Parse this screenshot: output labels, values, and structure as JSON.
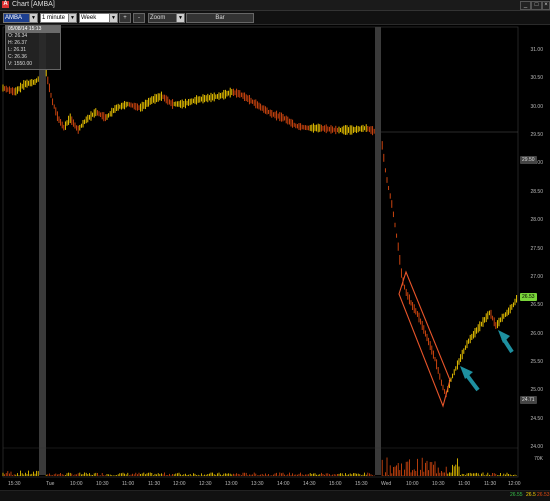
{
  "window": {
    "title": "Chart [AMBA]",
    "app_icon": "chart-app-icon",
    "controls": [
      "minimize",
      "maximize",
      "close"
    ]
  },
  "toolbar": {
    "symbol": "AMBA",
    "interval": "1 minute",
    "range": "Week",
    "plus_label": "+",
    "minus_label": "-",
    "zoom_label": "Zoom",
    "bar_label": "Bar"
  },
  "info": {
    "header": "05/08/14 15:13",
    "open": "O: 26.34",
    "high": "H: 26.37",
    "low": "L: 26.31",
    "close": "C: 26.36",
    "volume": "V: 1550.00"
  },
  "price_axis": [
    "31.00",
    "30.50",
    "30.00",
    "29.50",
    "29.00",
    "28.50",
    "28.00",
    "27.50",
    "27.00",
    "26.50",
    "26.00",
    "25.50",
    "25.00",
    "24.50",
    "24.00"
  ],
  "price_tags": {
    "prev_close": "29.50",
    "last": "26.53",
    "low_marker": "24.71"
  },
  "volume_label": "70K",
  "time_axis": [
    "15:30",
    "Tue",
    "10:00",
    "10:30",
    "11:00",
    "11:30",
    "12:00",
    "12:30",
    "13:00",
    "13:30",
    "14:00",
    "14:30",
    "15:00",
    "15:30",
    "Wed",
    "10:00",
    "10:30",
    "11:00",
    "11:30",
    "12:00"
  ],
  "bottom_quotes": {
    "bid": "26.55",
    "last": "26.5",
    "ask": "26.53"
  },
  "colors": {
    "background": "#000000",
    "up": "#ffd400",
    "down": "#e04b10",
    "annotation": "#e8552a",
    "arrow": "#1e90a0",
    "last_tag": "#7ad63a"
  }
}
